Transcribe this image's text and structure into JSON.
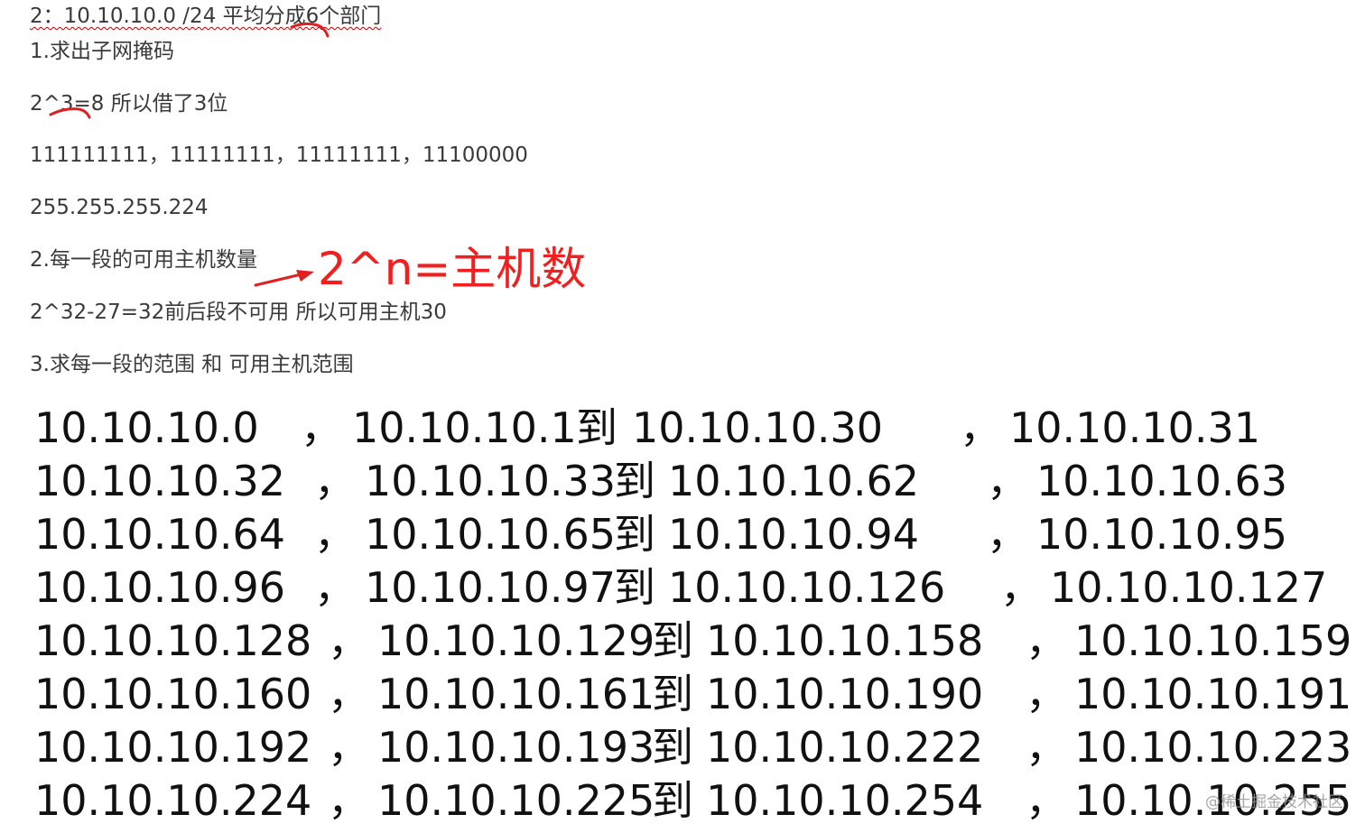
{
  "doc": {
    "line1": "2：10.10.10.0 /24 平均分成6个部门",
    "line2": "1.求出子网掩码",
    "line3": "2^3=8 所以借了3位",
    "line4": "111111111，11111111，11111111，11100000",
    "line5": "255.255.255.224",
    "line6": "2.每一段的可用主机数量",
    "line7": "2^32-27=32前后段不可用 所以可用主机30",
    "line8": "3.求每一段的范围 和 可用主机范围"
  },
  "annotation": {
    "text": "2^n=主机数",
    "color": "#f02020"
  },
  "subnets": [
    {
      "network": "10.10.10.0",
      "sep": "，",
      "first": "10.10.10.1",
      "to": "到",
      "last": "10.10.10.30",
      "sep2": "，",
      "broadcast": "10.10.10.31"
    },
    {
      "network": "10.10.10.32",
      "sep": "，",
      "first": "10.10.10.33",
      "to": "到",
      "last": "10.10.10.62",
      "sep2": "，",
      "broadcast": "10.10.10.63"
    },
    {
      "network": "10.10.10.64",
      "sep": "，",
      "first": "10.10.10.65",
      "to": "到",
      "last": "10.10.10.94",
      "sep2": "，",
      "broadcast": "10.10.10.95"
    },
    {
      "network": "10.10.10.96",
      "sep": "，",
      "first": "10.10.10.97",
      "to": "到",
      "last": "10.10.10.126",
      "sep2": "，",
      "broadcast": "10.10.10.127"
    },
    {
      "network": "10.10.10.128",
      "sep": "，",
      "first": "10.10.10.129",
      "to": "到",
      "last": "10.10.10.158",
      "sep2": "，",
      "broadcast": "10.10.10.159"
    },
    {
      "network": "10.10.10.160",
      "sep": "，",
      "first": "10.10.10.161",
      "to": "到",
      "last": "10.10.10.190",
      "sep2": "，",
      "broadcast": "10.10.10.191"
    },
    {
      "network": "10.10.10.192",
      "sep": "，",
      "first": "10.10.10.193",
      "to": "到",
      "last": "10.10.10.222",
      "sep2": "，",
      "broadcast": "10.10.10.223"
    },
    {
      "network": "10.10.10.224",
      "sep": "，",
      "first": "10.10.10.225",
      "to": "到",
      "last": "10.10.10.254",
      "sep2": "，",
      "broadcast": "10.10.10.255"
    }
  ],
  "watermark": "@稀土掘金技术社区"
}
